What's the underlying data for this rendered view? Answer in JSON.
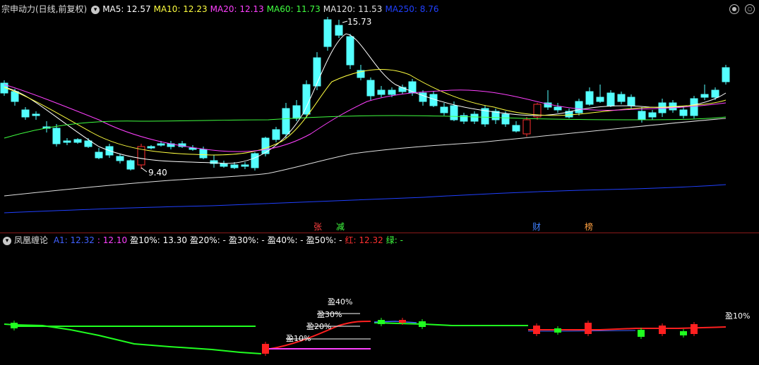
{
  "main": {
    "title": "宗申动力(日线,前复权)",
    "ma": [
      {
        "label": "MA5:",
        "value": "12.57",
        "color": "#ffffff"
      },
      {
        "label": "MA10:",
        "value": "12.23",
        "color": "#ffff40"
      },
      {
        "label": "MA20:",
        "value": "12.13",
        "color": "#ff40ff"
      },
      {
        "label": "MA60:",
        "value": "11.73",
        "color": "#40ff40"
      },
      {
        "label": "MA120:",
        "value": "11.53",
        "color": "#e0e0e0"
      },
      {
        "label": "MA250:",
        "value": "8.76",
        "color": "#2040ff"
      }
    ],
    "high_label": "15.73",
    "low_label": "9.40",
    "tags": [
      {
        "text": "张",
        "color": "#ff4040"
      },
      {
        "text": "减",
        "color": "#40ff40"
      },
      {
        "text": "财",
        "color": "#4080ff"
      },
      {
        "text": "榜",
        "color": "#ffa040"
      }
    ]
  },
  "indicator": {
    "title": "凤凰缠论",
    "items": [
      {
        "label": "A1:",
        "value": "12.32",
        "color": "#4060ff"
      },
      {
        "label": ":",
        "value": "12.10",
        "color": "#ff40ff"
      },
      {
        "label": "盈10%:",
        "value": "13.30",
        "color": "#ffffff"
      },
      {
        "label": "盈20%:",
        "value": "-",
        "color": "#ffffff"
      },
      {
        "label": "盈30%:",
        "value": "-",
        "color": "#ffffff"
      },
      {
        "label": "盈40%:",
        "value": "-",
        "color": "#ffffff"
      },
      {
        "label": "盈50%:",
        "value": "-",
        "color": "#ffffff"
      },
      {
        "label": "红:",
        "value": "12.32",
        "color": "#ff3030"
      },
      {
        "label": "绿:",
        "value": "-",
        "color": "#40ff40"
      }
    ],
    "levels": [
      "盈10%",
      "盈20%",
      "盈30%",
      "盈40%"
    ],
    "right_label": "盈10%"
  },
  "colors": {
    "up": "#ff3030",
    "down": "#54ffff",
    "ind_up": "#ff2020",
    "ind_down": "#20ff20"
  }
}
